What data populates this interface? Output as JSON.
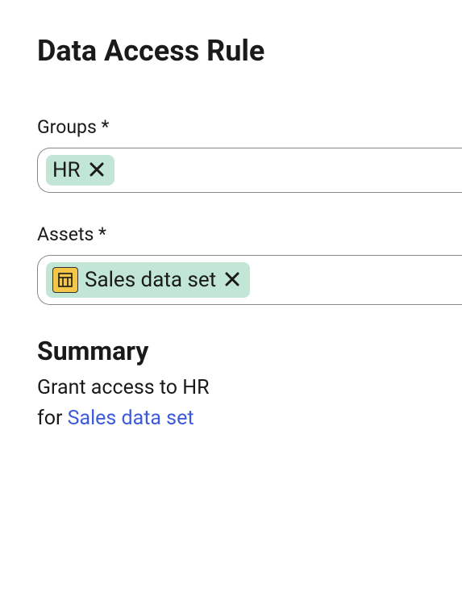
{
  "title": "Data Access Rule",
  "fields": {
    "groups": {
      "label": "Groups *",
      "chips": [
        {
          "label": "HR"
        }
      ]
    },
    "assets": {
      "label": "Assets *",
      "chips": [
        {
          "label": "Sales data set",
          "icon": "table-icon"
        }
      ]
    }
  },
  "summary": {
    "heading": "Summary",
    "prefix": "Grant access to ",
    "group": "HR",
    "middle": "for ",
    "asset_link": "Sales data set"
  }
}
